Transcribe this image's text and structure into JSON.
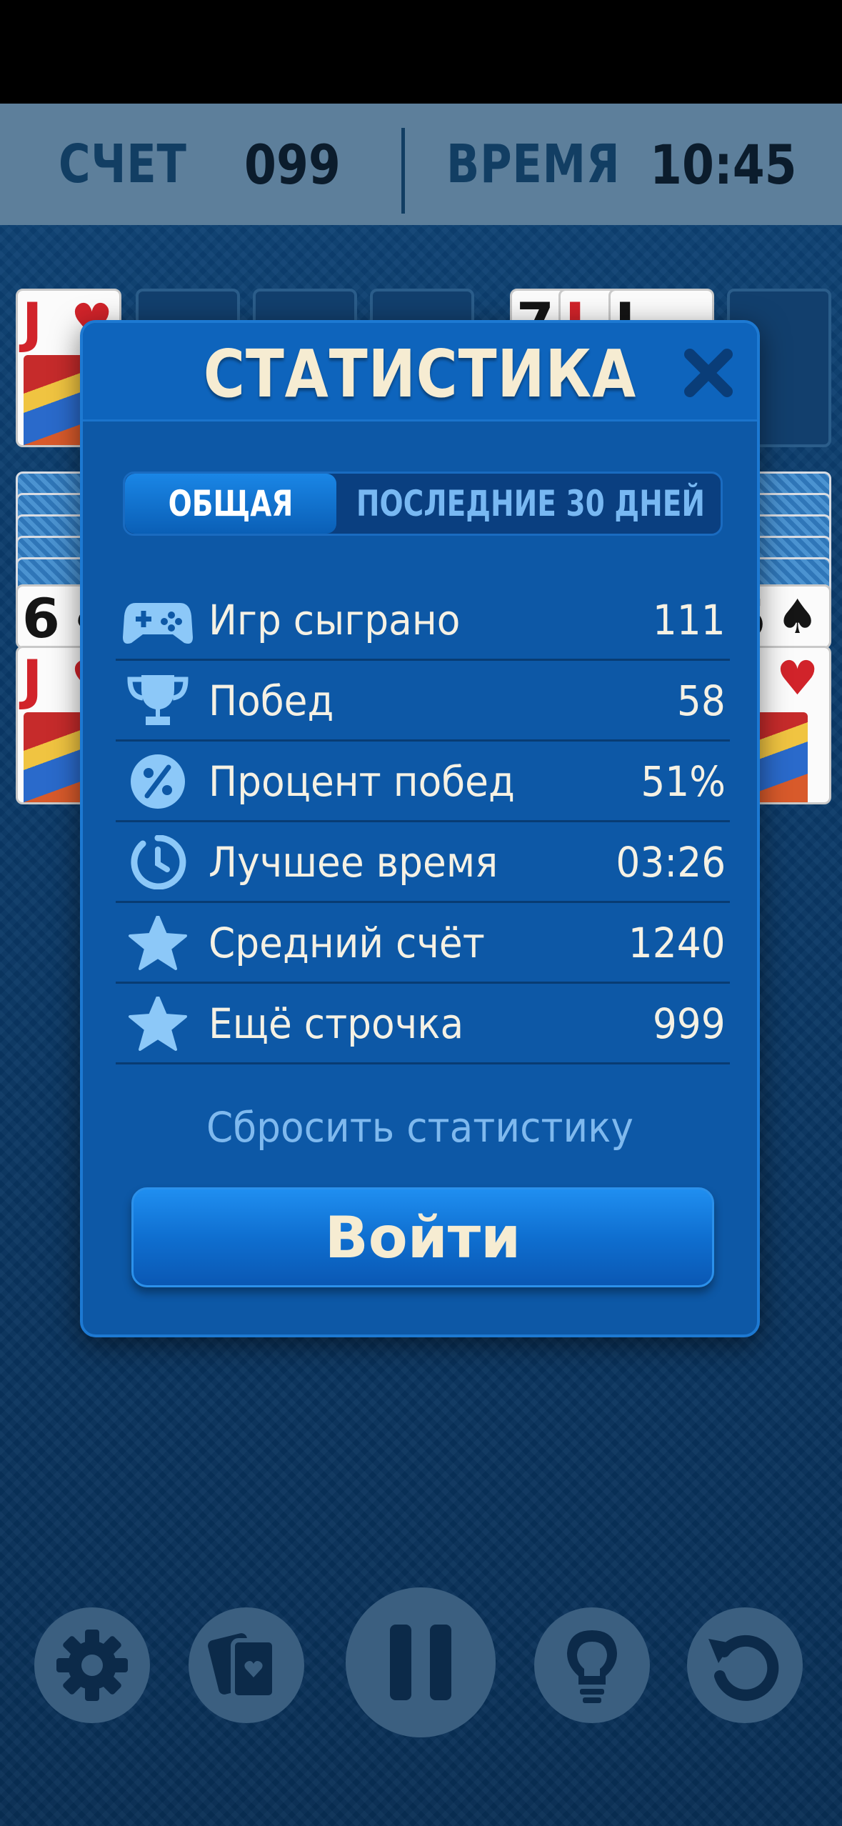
{
  "header": {
    "score_label": "СЧЕТ",
    "score_value": "099",
    "time_label": "ВРЕМЯ",
    "time_value": "10:45"
  },
  "board": {
    "foundation_card": {
      "rank": "J",
      "suit": "♥"
    },
    "waste_ranks": [
      "7",
      "J",
      "J"
    ],
    "tableau_left": [
      {
        "rank": "6",
        "suit": "♠"
      },
      {
        "rank": "J",
        "suit": "♥"
      }
    ],
    "tableau_right": [
      {
        "rank": "6",
        "suit": "♠"
      },
      {
        "rank": "J",
        "suit": "♥"
      }
    ]
  },
  "modal": {
    "title": "СТАТИСТИКА",
    "tabs": [
      {
        "label": "ОБЩАЯ",
        "active": true
      },
      {
        "label": "ПОСЛЕДНИЕ 30 ДНЕЙ",
        "active": false
      }
    ],
    "stats": [
      {
        "icon": "gamepad-icon",
        "label": "Игр сыграно",
        "value": "111"
      },
      {
        "icon": "trophy-icon",
        "label": "Побед",
        "value": "58"
      },
      {
        "icon": "percent-icon",
        "label": "Процент побед",
        "value": "51%"
      },
      {
        "icon": "clock-icon",
        "label": "Лучшее время",
        "value": "03:26"
      },
      {
        "icon": "star-icon",
        "label": "Средний счёт",
        "value": "1240"
      },
      {
        "icon": "star-icon",
        "label": "Ещё строчка",
        "value": "999"
      }
    ],
    "reset_label": "Сбросить статистику",
    "login_label": "Войти"
  },
  "toolbar": [
    "settings-icon",
    "cards-icon",
    "pause-icon",
    "hint-icon",
    "undo-icon"
  ],
  "colors": {
    "modal_bg": "#0d58a6",
    "header_bar": "#5d7f9b",
    "title_text": "#f6ecd2",
    "link_text": "#7fb9ee",
    "icon_color": "#8cc8f8"
  }
}
